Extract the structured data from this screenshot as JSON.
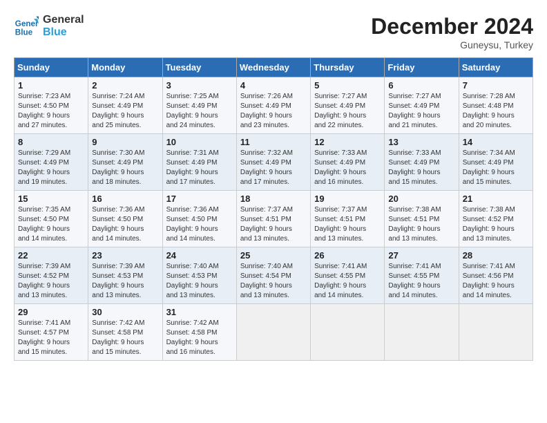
{
  "header": {
    "logo_line1": "General",
    "logo_line2": "Blue",
    "month_year": "December 2024",
    "location": "Guneysu, Turkey"
  },
  "weekdays": [
    "Sunday",
    "Monday",
    "Tuesday",
    "Wednesday",
    "Thursday",
    "Friday",
    "Saturday"
  ],
  "weeks": [
    [
      {
        "day": "1",
        "info": "Sunrise: 7:23 AM\nSunset: 4:50 PM\nDaylight: 9 hours\nand 27 minutes."
      },
      {
        "day": "2",
        "info": "Sunrise: 7:24 AM\nSunset: 4:49 PM\nDaylight: 9 hours\nand 25 minutes."
      },
      {
        "day": "3",
        "info": "Sunrise: 7:25 AM\nSunset: 4:49 PM\nDaylight: 9 hours\nand 24 minutes."
      },
      {
        "day": "4",
        "info": "Sunrise: 7:26 AM\nSunset: 4:49 PM\nDaylight: 9 hours\nand 23 minutes."
      },
      {
        "day": "5",
        "info": "Sunrise: 7:27 AM\nSunset: 4:49 PM\nDaylight: 9 hours\nand 22 minutes."
      },
      {
        "day": "6",
        "info": "Sunrise: 7:27 AM\nSunset: 4:49 PM\nDaylight: 9 hours\nand 21 minutes."
      },
      {
        "day": "7",
        "info": "Sunrise: 7:28 AM\nSunset: 4:48 PM\nDaylight: 9 hours\nand 20 minutes."
      }
    ],
    [
      {
        "day": "8",
        "info": "Sunrise: 7:29 AM\nSunset: 4:49 PM\nDaylight: 9 hours\nand 19 minutes."
      },
      {
        "day": "9",
        "info": "Sunrise: 7:30 AM\nSunset: 4:49 PM\nDaylight: 9 hours\nand 18 minutes."
      },
      {
        "day": "10",
        "info": "Sunrise: 7:31 AM\nSunset: 4:49 PM\nDaylight: 9 hours\nand 17 minutes."
      },
      {
        "day": "11",
        "info": "Sunrise: 7:32 AM\nSunset: 4:49 PM\nDaylight: 9 hours\nand 17 minutes."
      },
      {
        "day": "12",
        "info": "Sunrise: 7:33 AM\nSunset: 4:49 PM\nDaylight: 9 hours\nand 16 minutes."
      },
      {
        "day": "13",
        "info": "Sunrise: 7:33 AM\nSunset: 4:49 PM\nDaylight: 9 hours\nand 15 minutes."
      },
      {
        "day": "14",
        "info": "Sunrise: 7:34 AM\nSunset: 4:49 PM\nDaylight: 9 hours\nand 15 minutes."
      }
    ],
    [
      {
        "day": "15",
        "info": "Sunrise: 7:35 AM\nSunset: 4:50 PM\nDaylight: 9 hours\nand 14 minutes."
      },
      {
        "day": "16",
        "info": "Sunrise: 7:36 AM\nSunset: 4:50 PM\nDaylight: 9 hours\nand 14 minutes."
      },
      {
        "day": "17",
        "info": "Sunrise: 7:36 AM\nSunset: 4:50 PM\nDaylight: 9 hours\nand 14 minutes."
      },
      {
        "day": "18",
        "info": "Sunrise: 7:37 AM\nSunset: 4:51 PM\nDaylight: 9 hours\nand 13 minutes."
      },
      {
        "day": "19",
        "info": "Sunrise: 7:37 AM\nSunset: 4:51 PM\nDaylight: 9 hours\nand 13 minutes."
      },
      {
        "day": "20",
        "info": "Sunrise: 7:38 AM\nSunset: 4:51 PM\nDaylight: 9 hours\nand 13 minutes."
      },
      {
        "day": "21",
        "info": "Sunrise: 7:38 AM\nSunset: 4:52 PM\nDaylight: 9 hours\nand 13 minutes."
      }
    ],
    [
      {
        "day": "22",
        "info": "Sunrise: 7:39 AM\nSunset: 4:52 PM\nDaylight: 9 hours\nand 13 minutes."
      },
      {
        "day": "23",
        "info": "Sunrise: 7:39 AM\nSunset: 4:53 PM\nDaylight: 9 hours\nand 13 minutes."
      },
      {
        "day": "24",
        "info": "Sunrise: 7:40 AM\nSunset: 4:53 PM\nDaylight: 9 hours\nand 13 minutes."
      },
      {
        "day": "25",
        "info": "Sunrise: 7:40 AM\nSunset: 4:54 PM\nDaylight: 9 hours\nand 13 minutes."
      },
      {
        "day": "26",
        "info": "Sunrise: 7:41 AM\nSunset: 4:55 PM\nDaylight: 9 hours\nand 14 minutes."
      },
      {
        "day": "27",
        "info": "Sunrise: 7:41 AM\nSunset: 4:55 PM\nDaylight: 9 hours\nand 14 minutes."
      },
      {
        "day": "28",
        "info": "Sunrise: 7:41 AM\nSunset: 4:56 PM\nDaylight: 9 hours\nand 14 minutes."
      }
    ],
    [
      {
        "day": "29",
        "info": "Sunrise: 7:41 AM\nSunset: 4:57 PM\nDaylight: 9 hours\nand 15 minutes."
      },
      {
        "day": "30",
        "info": "Sunrise: 7:42 AM\nSunset: 4:58 PM\nDaylight: 9 hours\nand 15 minutes."
      },
      {
        "day": "31",
        "info": "Sunrise: 7:42 AM\nSunset: 4:58 PM\nDaylight: 9 hours\nand 16 minutes."
      },
      null,
      null,
      null,
      null
    ]
  ]
}
